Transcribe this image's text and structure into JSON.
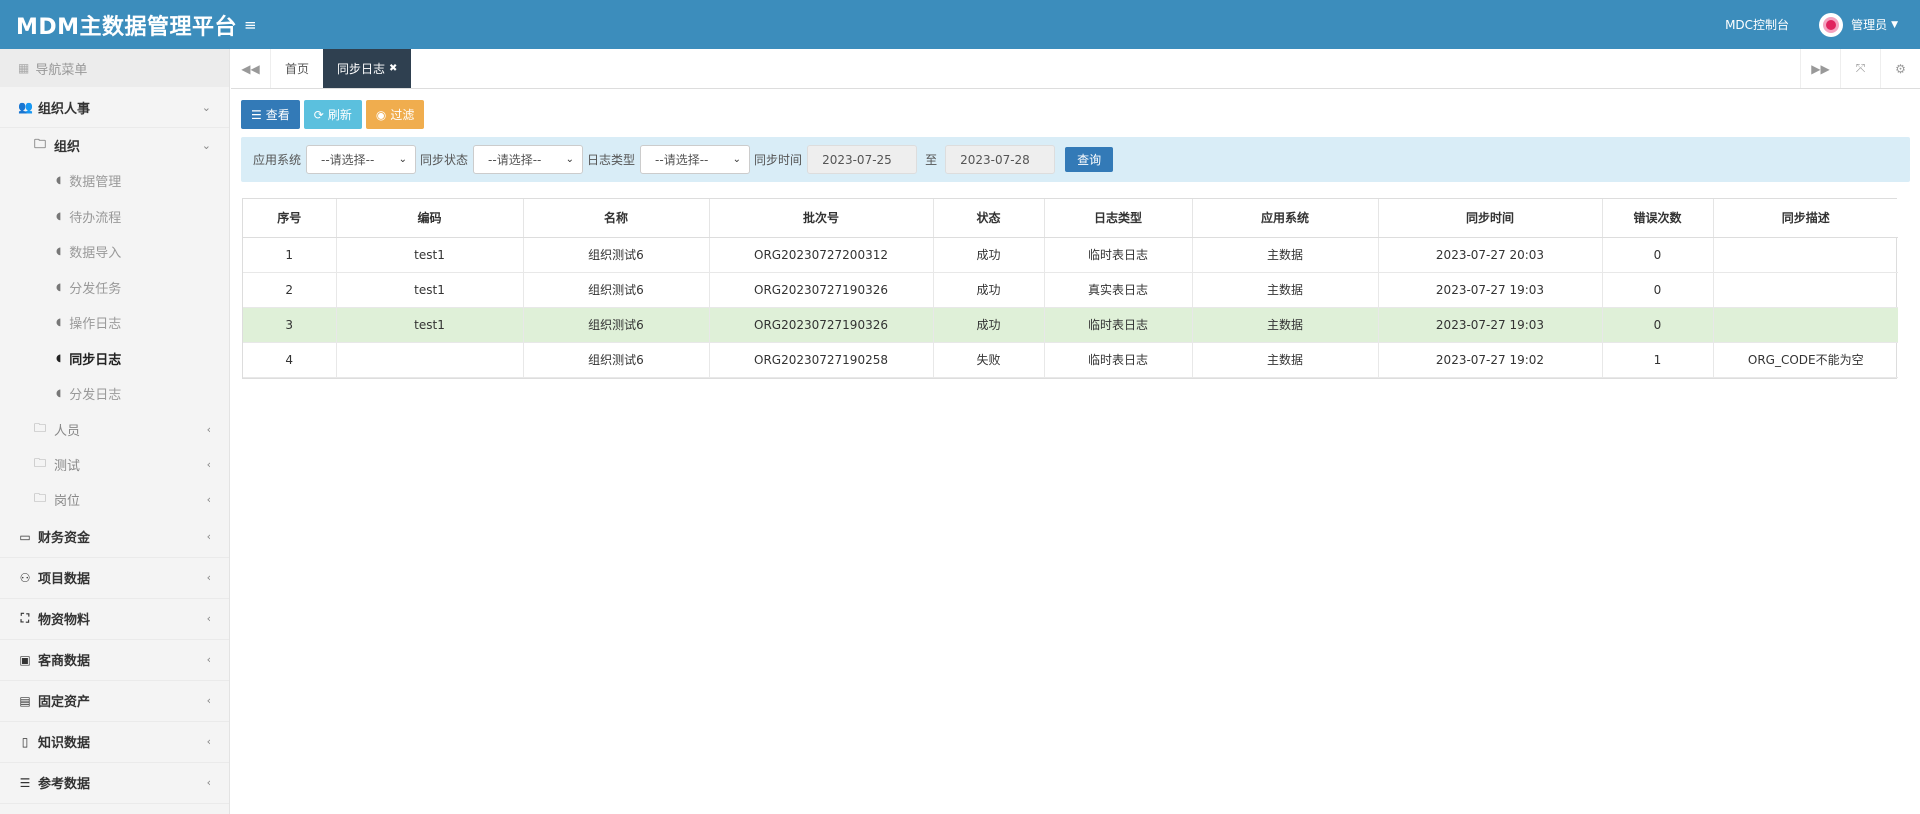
{
  "header": {
    "brand": "MDM主数据管理平台",
    "console_link": "MDC控制台",
    "user_name": "管理员"
  },
  "sidebar": {
    "nav_title": "导航菜单",
    "groups": [
      {
        "label": "组织人事",
        "icon": "users-icon"
      },
      {
        "label": "财务资金",
        "icon": "credit-card-icon"
      },
      {
        "label": "项目数据",
        "icon": "sitemap-icon"
      },
      {
        "label": "物资物料",
        "icon": "cubes-icon"
      },
      {
        "label": "客商数据",
        "icon": "briefcase-icon"
      },
      {
        "label": "固定资产",
        "icon": "archive-icon"
      },
      {
        "label": "知识数据",
        "icon": "file-icon"
      },
      {
        "label": "参考数据",
        "icon": "list-icon"
      }
    ],
    "subgroups": [
      "组织",
      "人员",
      "测试",
      "岗位"
    ],
    "org_items": [
      "数据管理",
      "待办流程",
      "数据导入",
      "分发任务",
      "操作日志",
      "同步日志",
      "分发日志"
    ]
  },
  "tabs": {
    "home": "首页",
    "current": "同步日志"
  },
  "toolbar": {
    "view": "查看",
    "refresh": "刷新",
    "filter": "过滤"
  },
  "filters": {
    "app_system_label": "应用系统",
    "sync_status_label": "同步状态",
    "log_type_label": "日志类型",
    "sync_time_label": "同步时间",
    "select_placeholder": "--请选择--",
    "date_from": "2023-07-25",
    "to_label": "至",
    "date_to": "2023-07-28",
    "query": "查询"
  },
  "table": {
    "headers": [
      "序号",
      "编码",
      "名称",
      "批次号",
      "状态",
      "日志类型",
      "应用系统",
      "同步时间",
      "错误次数",
      "同步描述"
    ],
    "rows": [
      [
        "1",
        "test1",
        "组织测试6",
        "ORG20230727200312",
        "成功",
        "临时表日志",
        "主数据",
        "2023-07-27 20:03",
        "0",
        ""
      ],
      [
        "2",
        "test1",
        "组织测试6",
        "ORG20230727190326",
        "成功",
        "真实表日志",
        "主数据",
        "2023-07-27 19:03",
        "0",
        ""
      ],
      [
        "3",
        "test1",
        "组织测试6",
        "ORG20230727190326",
        "成功",
        "临时表日志",
        "主数据",
        "2023-07-27 19:03",
        "0",
        ""
      ],
      [
        "4",
        "",
        "组织测试6",
        "ORG20230727190258",
        "失败",
        "临时表日志",
        "主数据",
        "2023-07-27 19:02",
        "1",
        "ORG_CODE不能为空"
      ]
    ]
  }
}
